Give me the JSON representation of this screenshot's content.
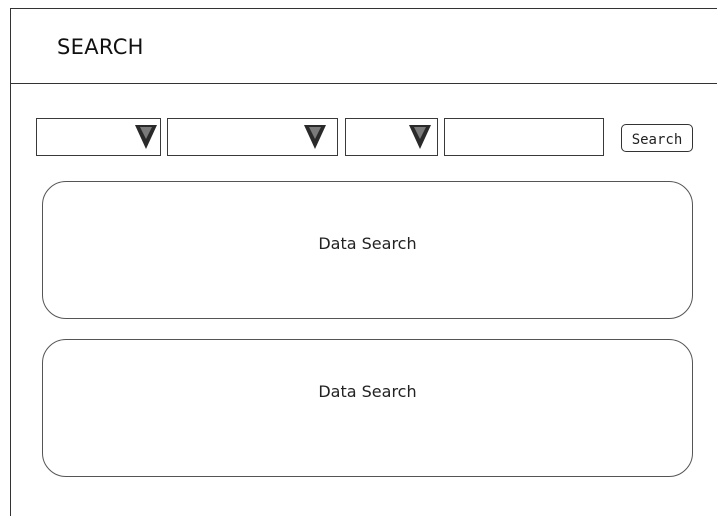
{
  "header": {
    "title": "SEARCH"
  },
  "filters": {
    "dropdowns": [
      {
        "selected": ""
      },
      {
        "selected": ""
      },
      {
        "selected": ""
      }
    ],
    "search_input_value": "",
    "search_button_label": "Search"
  },
  "results": {
    "panels": [
      {
        "label": "Data Search"
      },
      {
        "label": "Data Search"
      }
    ]
  },
  "icons": {
    "dropdown_arrow": "chevron-down-icon"
  }
}
